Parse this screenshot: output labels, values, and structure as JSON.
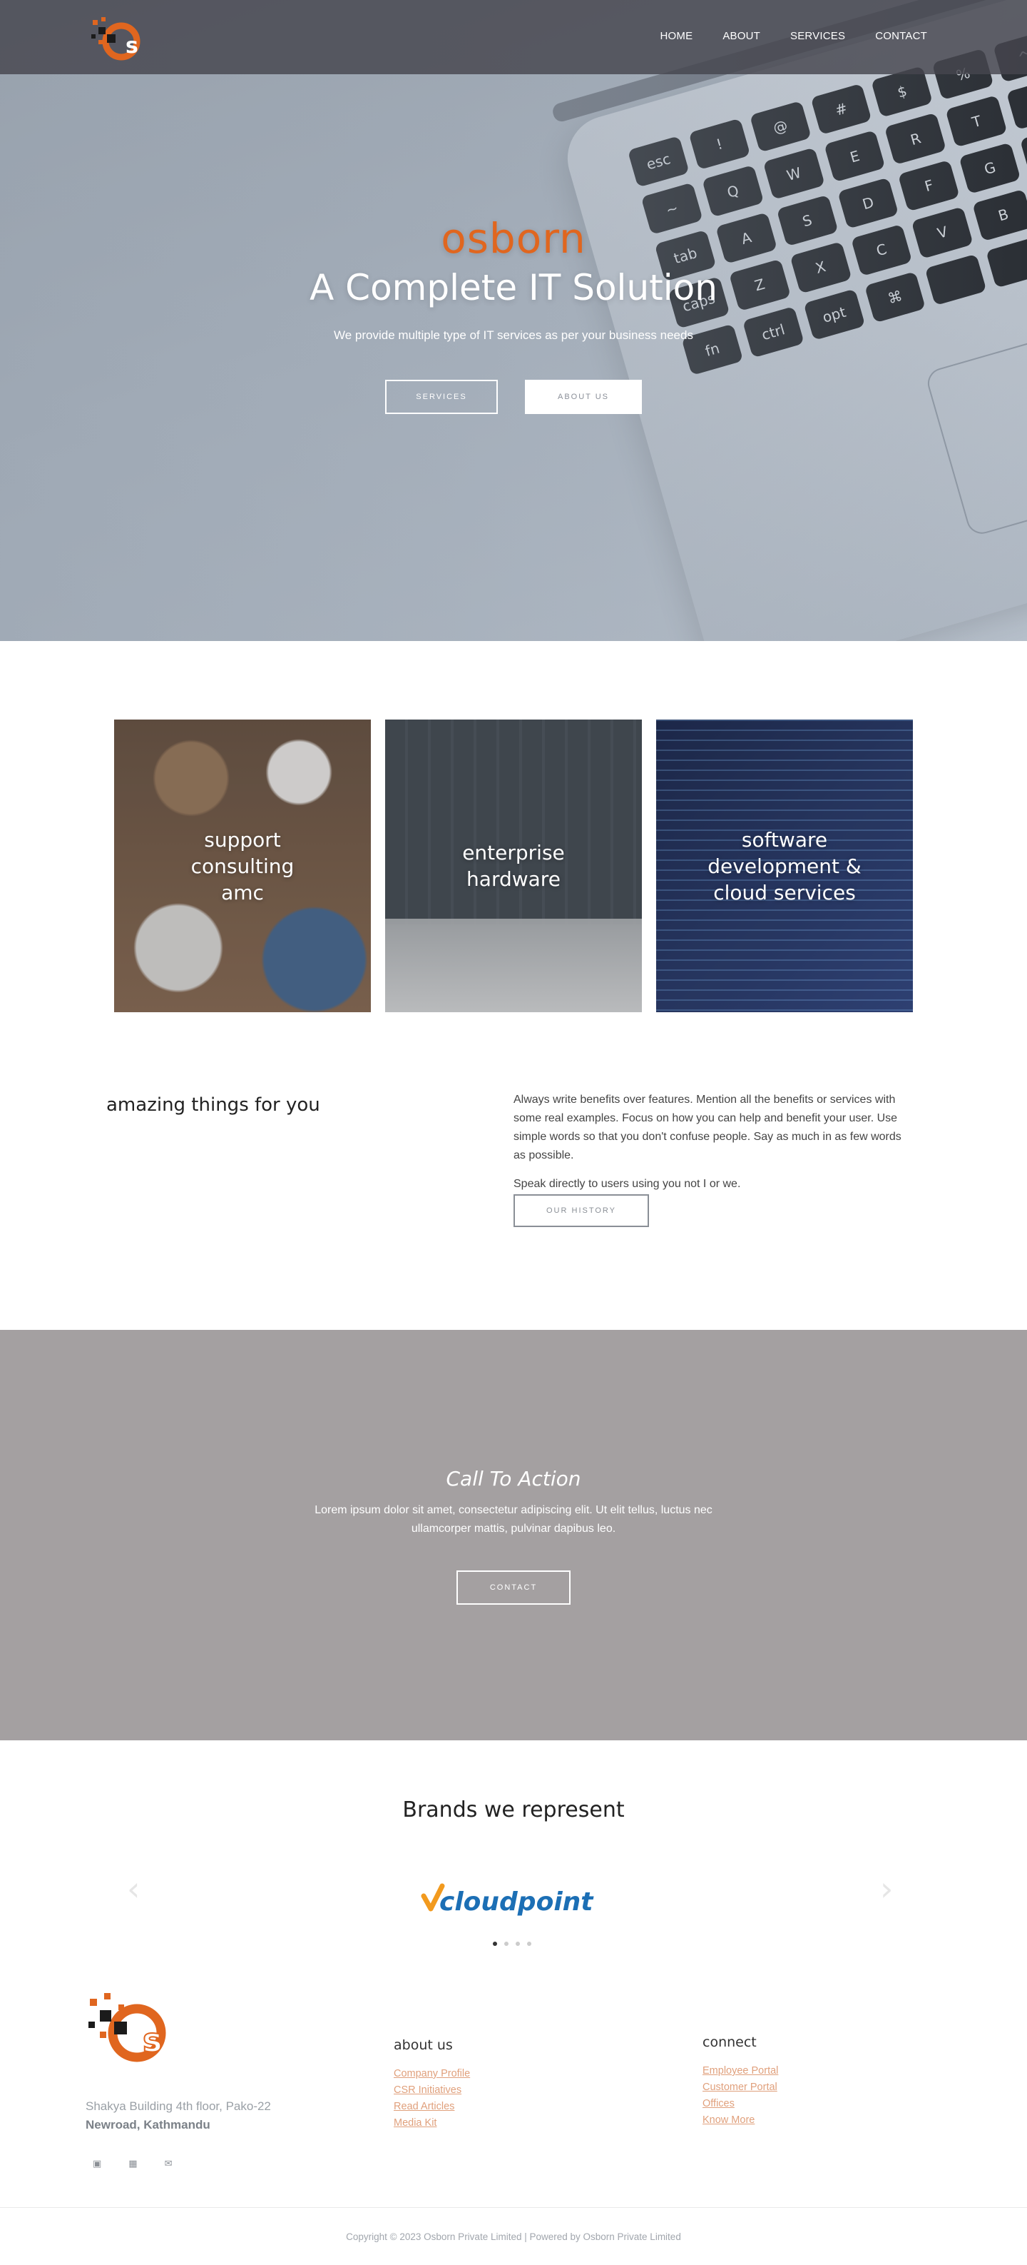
{
  "header": {
    "logo_alt": "Osborn logo",
    "nav": [
      "HOME",
      "ABOUT",
      "SERVICES",
      "CONTACT"
    ]
  },
  "hero": {
    "brand": "osborn",
    "title": "A Complete IT Solution",
    "subtitle": "We provide multiple type of IT services as per your business needs",
    "button_services": "SERVICES",
    "button_about": "ABOUT US"
  },
  "cards": [
    {
      "label": "support\nconsulting\namc"
    },
    {
      "label": "enterprise\nhardware"
    },
    {
      "label": "software\ndevelopment &\ncloud services"
    }
  ],
  "amazing": {
    "title": "amazing things for you",
    "paragraph_1": "Always write benefits over features. Mention all the benefits or services with some real examples. Focus on how you can help and benefit your user. Use simple words so that you don't confuse people. Say as much in as few words as possible.",
    "paragraph_2": "Speak directly to users using you not I or we.",
    "button": "OUR HISTORY"
  },
  "cta": {
    "title": "Call To Action",
    "text": "Lorem ipsum dolor sit amet, consectetur adipiscing elit. Ut elit tellus, luctus nec ullamcorper mattis, pulvinar dapibus leo.",
    "button": "CONTACT"
  },
  "brands": {
    "title": "Brands we represent",
    "logo_text": "cloudpoint",
    "prev_icon": "‹",
    "next_icon": "›",
    "active_slide": 1,
    "total_slides": 4
  },
  "footer": {
    "address_line_1": "Shakya Building 4th floor, Pako-22",
    "address_line_2": "Newroad, Kathmandu",
    "socials": [
      "facebook-icon",
      "linkedin-icon",
      "email-icon"
    ],
    "about_title": "about us",
    "about_links": [
      "Company Profile",
      "CSR Initiatives",
      "Read Articles",
      "Media Kit"
    ],
    "connect_title": "connect",
    "connect_links": [
      "Employee Portal",
      "Customer Portal",
      "Offices",
      "Know More"
    ]
  },
  "copyright": "Copyright © 2023 Osborn Private Limited | Powered by Osborn Private Limited",
  "colors": {
    "brand_orange": "#e0661f",
    "link_peach": "#e0a07c",
    "cta_gray": "#a4a0a1",
    "topbar": "#46464e"
  }
}
